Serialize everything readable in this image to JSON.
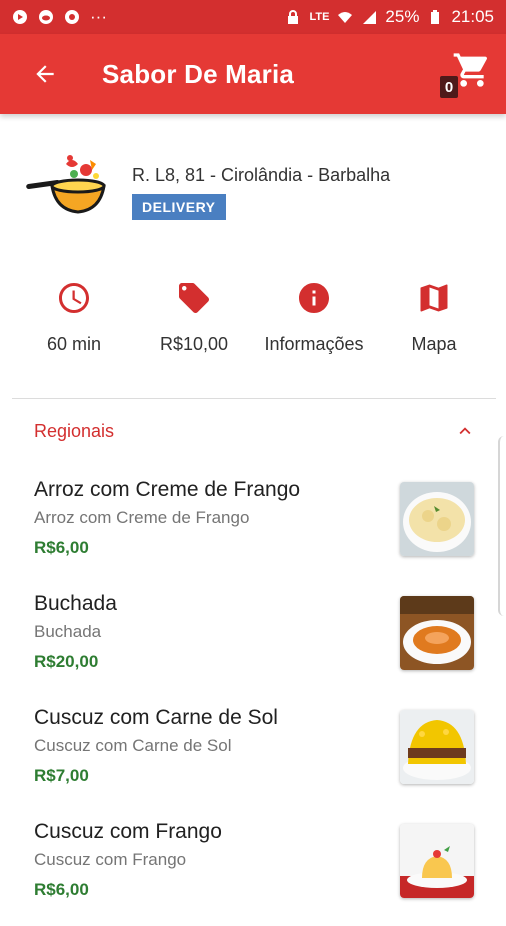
{
  "status_bar": {
    "battery": "25%",
    "time": "21:05",
    "network": "LTE",
    "more": "···"
  },
  "app_bar": {
    "title": "Sabor De Maria",
    "cart_count": "0"
  },
  "shop": {
    "address": "R. L8, 81 - Cirolândia - Barbalha",
    "badge": "DELIVERY"
  },
  "features": [
    {
      "icon": "clock-icon",
      "label": "60 min"
    },
    {
      "icon": "tag-icon",
      "label": "R$10,00"
    },
    {
      "icon": "info-icon",
      "label": "Informações"
    },
    {
      "icon": "map-icon",
      "label": "Mapa"
    }
  ],
  "category": {
    "label": "Regionais",
    "expanded": true
  },
  "items": [
    {
      "name": "Arroz com Creme de Frango",
      "description": "Arroz com Creme de Frango",
      "price": "R$6,00"
    },
    {
      "name": "Buchada",
      "description": "Buchada",
      "price": "R$20,00"
    },
    {
      "name": "Cuscuz com Carne de Sol",
      "description": "Cuscuz com Carne de Sol",
      "price": "R$7,00"
    },
    {
      "name": "Cuscuz com Frango",
      "description": "Cuscuz com Frango",
      "price": "R$6,00"
    }
  ],
  "colors": {
    "primary": "#e53935",
    "status_bar": "#d32f2f",
    "price": "#2e7d32",
    "badge": "#4a7fc1",
    "icon": "#d32f2f"
  }
}
